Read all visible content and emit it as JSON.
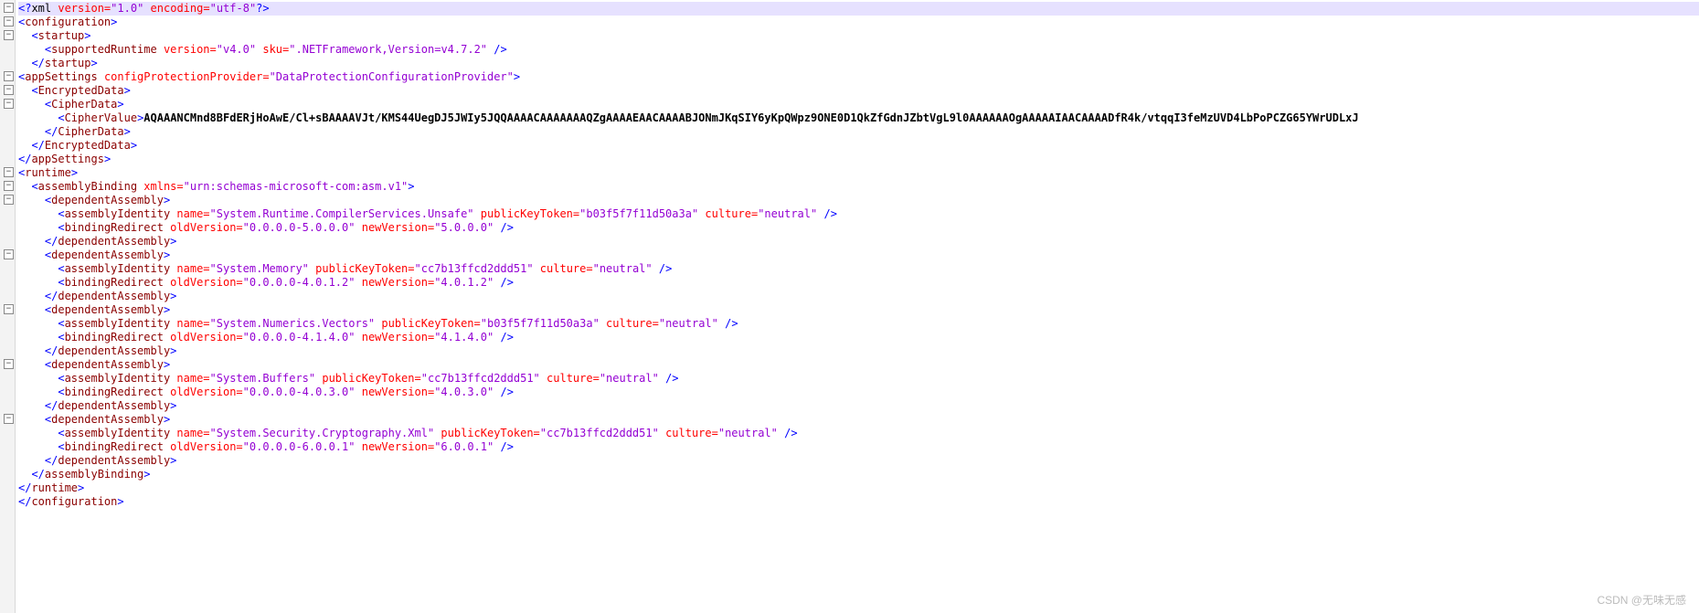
{
  "declaration": {
    "version": "1.0",
    "encoding": "utf-8"
  },
  "startup": {
    "supportedRuntime": {
      "version": "v4.0",
      "sku": ".NETFramework,Version=v4.7.2"
    }
  },
  "appSettings": {
    "configProtectionProvider": "DataProtectionConfigurationProvider",
    "cipherValue": "AQAAANCMnd8BFdERjHoAwE/Cl+sBAAAAVJt/KMS44UegDJ5JWIy5JQQAAAACAAAAAAAQZgAAAAEAACAAAABJONmJKqSIY6yKpQWpz9ONE0D1QkZfGdnJZbtVgL9l0AAAAAAOgAAAAAIAACAAAADfR4k/vtqqI3feMzUVD4LbPoPCZG65YWrUDLxJ"
  },
  "assemblyBinding": {
    "xmlns": "urn:schemas-microsoft-com:asm.v1",
    "dependentAssemblies": [
      {
        "name": "System.Runtime.CompilerServices.Unsafe",
        "publicKeyToken": "b03f5f7f11d50a3a",
        "culture": "neutral",
        "oldVersion": "0.0.0.0-5.0.0.0",
        "newVersion": "5.0.0.0"
      },
      {
        "name": "System.Memory",
        "publicKeyToken": "cc7b13ffcd2ddd51",
        "culture": "neutral",
        "oldVersion": "0.0.0.0-4.0.1.2",
        "newVersion": "4.0.1.2"
      },
      {
        "name": "System.Numerics.Vectors",
        "publicKeyToken": "b03f5f7f11d50a3a",
        "culture": "neutral",
        "oldVersion": "0.0.0.0-4.1.4.0",
        "newVersion": "4.1.4.0"
      },
      {
        "name": "System.Buffers",
        "publicKeyToken": "cc7b13ffcd2ddd51",
        "culture": "neutral",
        "oldVersion": "0.0.0.0-4.0.3.0",
        "newVersion": "4.0.3.0"
      },
      {
        "name": "System.Security.Cryptography.Xml",
        "publicKeyToken": "cc7b13ffcd2ddd51",
        "culture": "neutral",
        "oldVersion": "0.0.0.0-6.0.0.1",
        "newVersion": "6.0.0.1"
      }
    ]
  },
  "watermark": "CSDN @无味无感"
}
